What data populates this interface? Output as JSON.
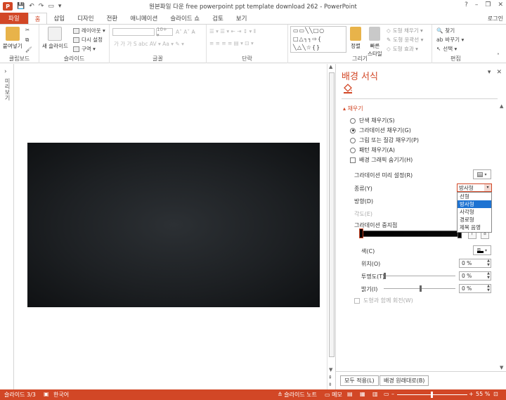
{
  "app": {
    "logo": "P",
    "title": "원본파일 다운 free powerpoint ppt template download 262 - PowerPoint",
    "login": "로그인"
  },
  "qat": {
    "save_icon": "save-icon",
    "undo_icon": "undo-icon",
    "redo_icon": "redo-icon"
  },
  "window": {
    "help": "?",
    "minimize": "–",
    "restore": "❐",
    "close": "✕"
  },
  "tabs": [
    {
      "label": "파일"
    },
    {
      "label": "홈"
    },
    {
      "label": "삽입"
    },
    {
      "label": "디자인"
    },
    {
      "label": "전환"
    },
    {
      "label": "애니메이션"
    },
    {
      "label": "슬라이드 쇼"
    },
    {
      "label": "검토"
    },
    {
      "label": "보기"
    }
  ],
  "ribbon": {
    "clipboard": {
      "label": "클립보드",
      "paste": "붙여넣기"
    },
    "slides": {
      "label": "슬라이드",
      "new_slide": "새 슬라이드",
      "layout": "레이아웃 ▾",
      "reset": "다시 설정",
      "section": "구역 ▾"
    },
    "font": {
      "label": "글꼴",
      "size": "10+ ▾"
    },
    "paragraph": {
      "label": "단락"
    },
    "drawing": {
      "label": "그리기",
      "shapes": "▭▭╲╲□○\n□△┐┐⇨{\n╲△╲☆{}",
      "arrange": "정렬",
      "quick_styles": "빠른\n스타일",
      "fill": "도형 채우기 ▾",
      "outline": "도형 윤곽선 ▾",
      "effects": "도형 효과 ▾"
    },
    "editing": {
      "label": "편집",
      "find": "찾기",
      "replace": "바꾸기 ▾",
      "select": "선택 ▾"
    }
  },
  "left_pane": {
    "label": "미리보기"
  },
  "format_pane": {
    "title": "배경 서식",
    "section_fill": "채우기",
    "fill_options": [
      {
        "label": "단색 채우기(S)",
        "checked": false
      },
      {
        "label": "그라데이션 채우기(G)",
        "checked": true
      },
      {
        "label": "그림 또는 질감 채우기(P)",
        "checked": false
      },
      {
        "label": "패턴 채우기(A)",
        "checked": false
      }
    ],
    "hide_bg": "배경 그래픽 숨기기(H)",
    "preset_label": "그라데이션 미리 설정(R)",
    "type_label": "종류(Y)",
    "type_value": "방사형",
    "type_options": [
      "선형",
      "방사형",
      "사각형",
      "경로형",
      "제목 음영"
    ],
    "type_selected_index": 1,
    "direction_label": "방향(D)",
    "angle_label": "각도(E)",
    "stops_label": "그라데이션 중지점",
    "color_label": "색(C)",
    "position_label": "위치(O)",
    "position_value": "0 %",
    "transparency_label": "투명도(T)",
    "transparency_value": "0 %",
    "transparency_level": 0,
    "brightness_label": "밝기(I)",
    "brightness_value": "0 %",
    "brightness_level": 0.5,
    "rotate_label": "도형과 함께 회전(W)",
    "apply_all": "모두 적용(L)",
    "reset_bg": "배경 원래대로(B)"
  },
  "statusbar": {
    "slide": "슬라이드 3/3",
    "lang": "한국어",
    "notes": "슬라이드 노트",
    "comments": "메모",
    "zoom": "55 %",
    "zoom_level": 0.55
  },
  "colors": {
    "accent": "#d24726",
    "selection": "#1e73d2"
  }
}
